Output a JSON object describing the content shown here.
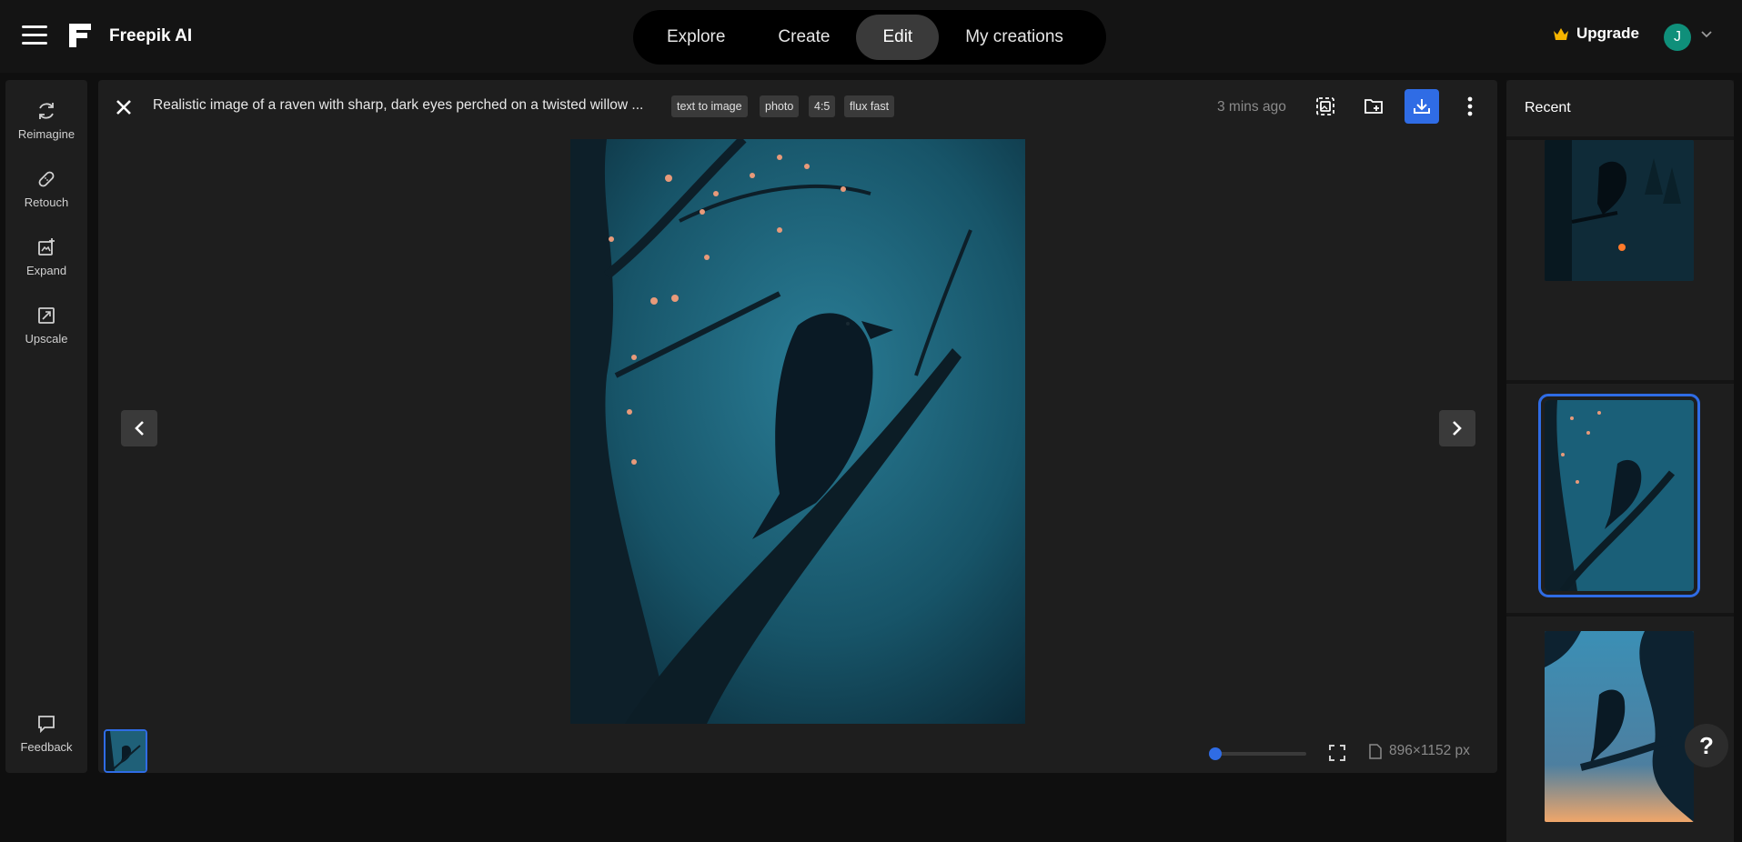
{
  "app": {
    "brand": "Freepik AI"
  },
  "nav": {
    "tabs": [
      {
        "label": "Explore"
      },
      {
        "label": "Create"
      },
      {
        "label": "Edit"
      },
      {
        "label": "My creations"
      }
    ],
    "active_tab": "Edit",
    "upgrade_label": "Upgrade",
    "avatar_initial": "J"
  },
  "tools": [
    {
      "label": "Reimagine",
      "icon": "reimagine-icon"
    },
    {
      "label": "Retouch",
      "icon": "bandage-icon"
    },
    {
      "label": "Expand",
      "icon": "expand-icon"
    },
    {
      "label": "Upscale",
      "icon": "upscale-icon"
    }
  ],
  "feedback_label": "Feedback",
  "viewer": {
    "prompt": "Realistic image of a raven with sharp, dark eyes perched on a twisted willow ...",
    "tags": [
      "text to image",
      "photo",
      "4:5",
      "flux fast"
    ],
    "time": "3 mins ago",
    "dimensions": "896×1152 px",
    "zoom_fraction": 0.0
  },
  "recent": {
    "title": "Recent"
  },
  "help_label": "?",
  "colors": {
    "accent": "#2f6ce5",
    "background": "#0f0f0f",
    "panel": "#1e1e1e",
    "avatar": "#0f8f7a",
    "crown": "#f5b400"
  }
}
